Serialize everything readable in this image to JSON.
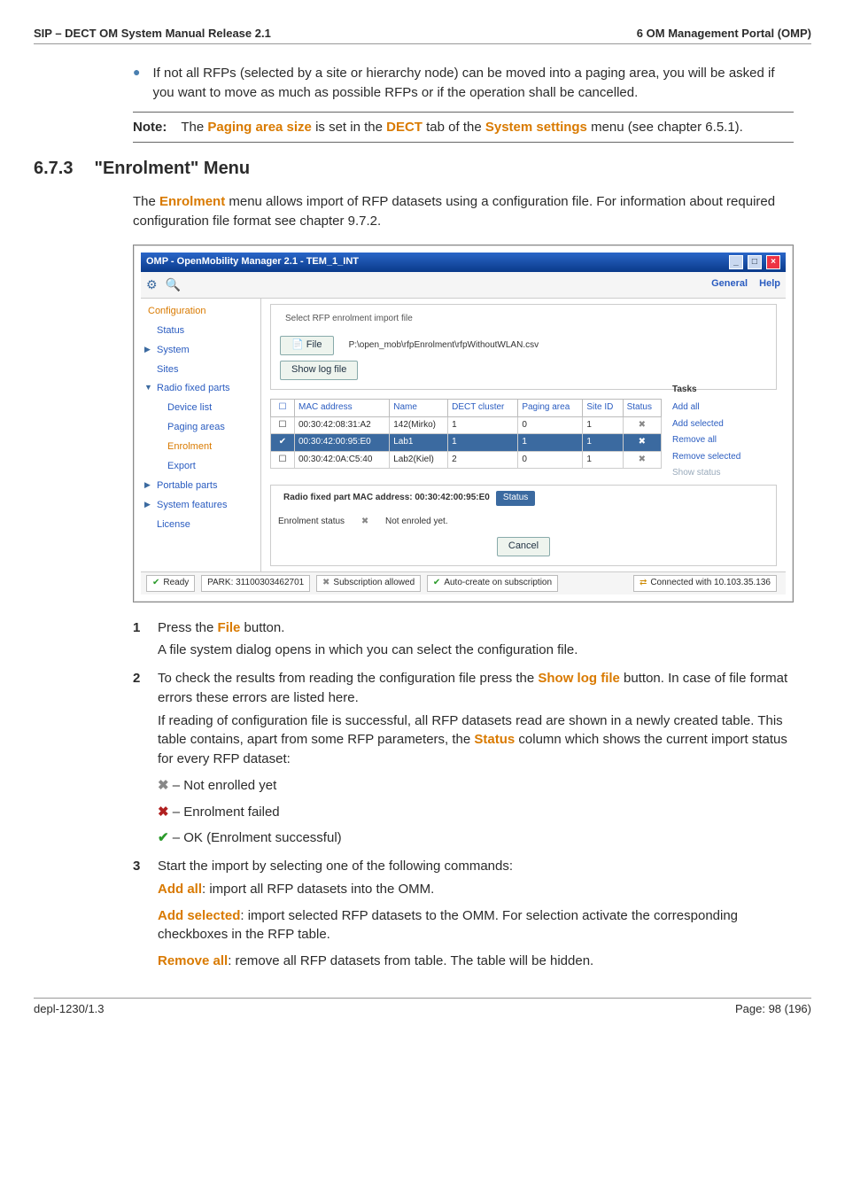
{
  "header": {
    "left": "SIP – DECT OM System Manual Release 2.1",
    "right": "6 OM Management Portal (OMP)"
  },
  "bullet": "If not all RFPs (selected by a site or hierarchy node) can be moved into a paging area, you will be asked if you want to move as much as possible RFPs or if the operation shall be cancelled.",
  "note": {
    "label": "Note:",
    "pre": "The ",
    "k1": "Paging area size",
    "mid1": " is set in the ",
    "k2": "DECT",
    "mid2": " tab of the ",
    "k3": "System settings",
    "post": " menu (see chapter 6.5.1)."
  },
  "section": {
    "num": "6.7.3",
    "title": "\"Enrolment\" Menu"
  },
  "intro": {
    "pre": "The ",
    "k": "Enrolment",
    "post": " menu allows import of RFP datasets using a configuration file. For information about required configuration file format see chapter 9.7.2."
  },
  "app": {
    "title": "OMP - OpenMobility Manager 2.1 - TEM_1_INT",
    "help": {
      "general": "General",
      "help": "Help"
    },
    "sidebar": {
      "top": "Configuration",
      "items": [
        "Status",
        "System",
        "Sites",
        "Radio fixed parts",
        "Device list",
        "Paging areas",
        "Enrolment",
        "Export",
        "Portable parts",
        "System features",
        "License"
      ]
    },
    "importbox": {
      "legend": "Select RFP enrolment import file",
      "file_btn": "File",
      "path": "P:\\open_mob\\rfpEnrolment\\rfpWithoutWLAN.csv",
      "log_btn": "Show log file"
    },
    "grid": {
      "cols": [
        "MAC address",
        "Name",
        "DECT cluster",
        "Paging area",
        "Site ID",
        "Status"
      ],
      "rows": [
        {
          "chk": "",
          "mac": "00:30:42:08:31:A2",
          "name": "142(Mirko)",
          "dect": "1",
          "pa": "0",
          "site": "1",
          "status": "✖"
        },
        {
          "chk": "✔",
          "mac": "00:30:42:00:95:E0",
          "name": "Lab1",
          "dect": "1",
          "pa": "1",
          "site": "1",
          "status": "✖",
          "sel": true
        },
        {
          "chk": "",
          "mac": "00:30:42:0A:C5:40",
          "name": "Lab2(Kiel)",
          "dect": "2",
          "pa": "0",
          "site": "1",
          "status": "✖"
        }
      ]
    },
    "tasks": {
      "title": "Tasks",
      "add_all": "Add all",
      "add_sel": "Add selected",
      "rem_all": "Remove all",
      "rem_sel": "Remove selected",
      "show": "Show status"
    },
    "detail": {
      "legend": "Radio fixed part MAC address: 00:30:42:00:95:E0",
      "status_tab": "Status",
      "enrol_lbl": "Enrolment status",
      "enrol_val": "Not enroled yet.",
      "cancel": "Cancel"
    },
    "statusbar": {
      "ready": "Ready",
      "park": "PARK: 31100303462701",
      "sub": "Subscription allowed",
      "auto": "Auto-create on subscription",
      "conn": "Connected with 10.103.35.136"
    }
  },
  "steps": {
    "s1_pre": "Press the ",
    "s1_k": "File",
    "s1_post": " button.",
    "s1_sub": "A file system dialog opens in which you can select the configuration file.",
    "s2_pre": "To check the results from reading the configuration file press the ",
    "s2_k": "Show log file",
    "s2_post": " button. In case of file format errors these errors are listed here.",
    "s2_sub_pre": "If reading of configuration file is successful, all RFP datasets read are shown in a newly created table. This table contains, apart from some RFP parameters, the ",
    "s2_sub_k": "Status",
    "s2_sub_post": " column which shows the current import status for every RFP dataset:",
    "legend_not": " – Not enrolled yet",
    "legend_fail": " – Enrolment failed",
    "legend_ok": " – OK (Enrolment successful)",
    "s3": "Start the import by selecting one of the following commands:",
    "addall_k": "Add all",
    "addall_t": ": import all RFP datasets into the OMM.",
    "addsel_k": "Add selected",
    "addsel_t": ": import selected RFP datasets to the OMM. For selection activate the corresponding checkboxes in the RFP table.",
    "remall_k": "Remove all",
    "remall_t": ": remove all RFP datasets from table. The table will be hidden."
  },
  "footer": {
    "left": "depl-1230/1.3",
    "right": "Page: 98 (196)"
  },
  "chart_data": {
    "type": "table",
    "title": "RFP enrolment import table",
    "columns": [
      "MAC address",
      "Name",
      "DECT cluster",
      "Paging area",
      "Site ID",
      "Status"
    ],
    "rows": [
      [
        "00:30:42:08:31:A2",
        "142(Mirko)",
        "1",
        "0",
        "1",
        "not enrolled"
      ],
      [
        "00:30:42:00:95:E0",
        "Lab1",
        "1",
        "1",
        "1",
        "not enrolled"
      ],
      [
        "00:30:42:0A:C5:40",
        "Lab2(Kiel)",
        "2",
        "0",
        "1",
        "not enrolled"
      ]
    ]
  }
}
